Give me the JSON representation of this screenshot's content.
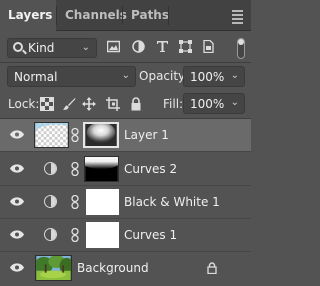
{
  "tabs": [
    {
      "label": "Layers",
      "active": true
    },
    {
      "label": "Channels",
      "active": false
    },
    {
      "label": "Paths",
      "active": false
    }
  ],
  "filter": {
    "kind_label": "Kind",
    "icons": [
      "image-filter-icon",
      "adjustment-filter-icon",
      "type-filter-icon",
      "shape-filter-icon",
      "smart-object-filter-icon"
    ],
    "filter_toggle": "on"
  },
  "blend": {
    "mode": "Normal",
    "opacity_label": "Opacity:",
    "opacity_value": "100%"
  },
  "lock": {
    "label": "Lock:",
    "fill_label": "Fill:",
    "fill_value": "100%"
  },
  "layers": [
    {
      "name": "Layer 1",
      "type": "pixel-with-mask",
      "selected": true,
      "visible": true
    },
    {
      "name": "Curves 2",
      "type": "adjustment",
      "selected": false,
      "visible": true
    },
    {
      "name": "Black & White 1",
      "type": "adjustment",
      "selected": false,
      "visible": true
    },
    {
      "name": "Curves 1",
      "type": "adjustment",
      "selected": false,
      "visible": true
    },
    {
      "name": "Background",
      "type": "background",
      "selected": false,
      "visible": true,
      "locked": true
    }
  ],
  "colors": {
    "panel": "#535353",
    "tabbar": "#424242",
    "selected_row": "#6a6a6a",
    "field": "#454545"
  }
}
